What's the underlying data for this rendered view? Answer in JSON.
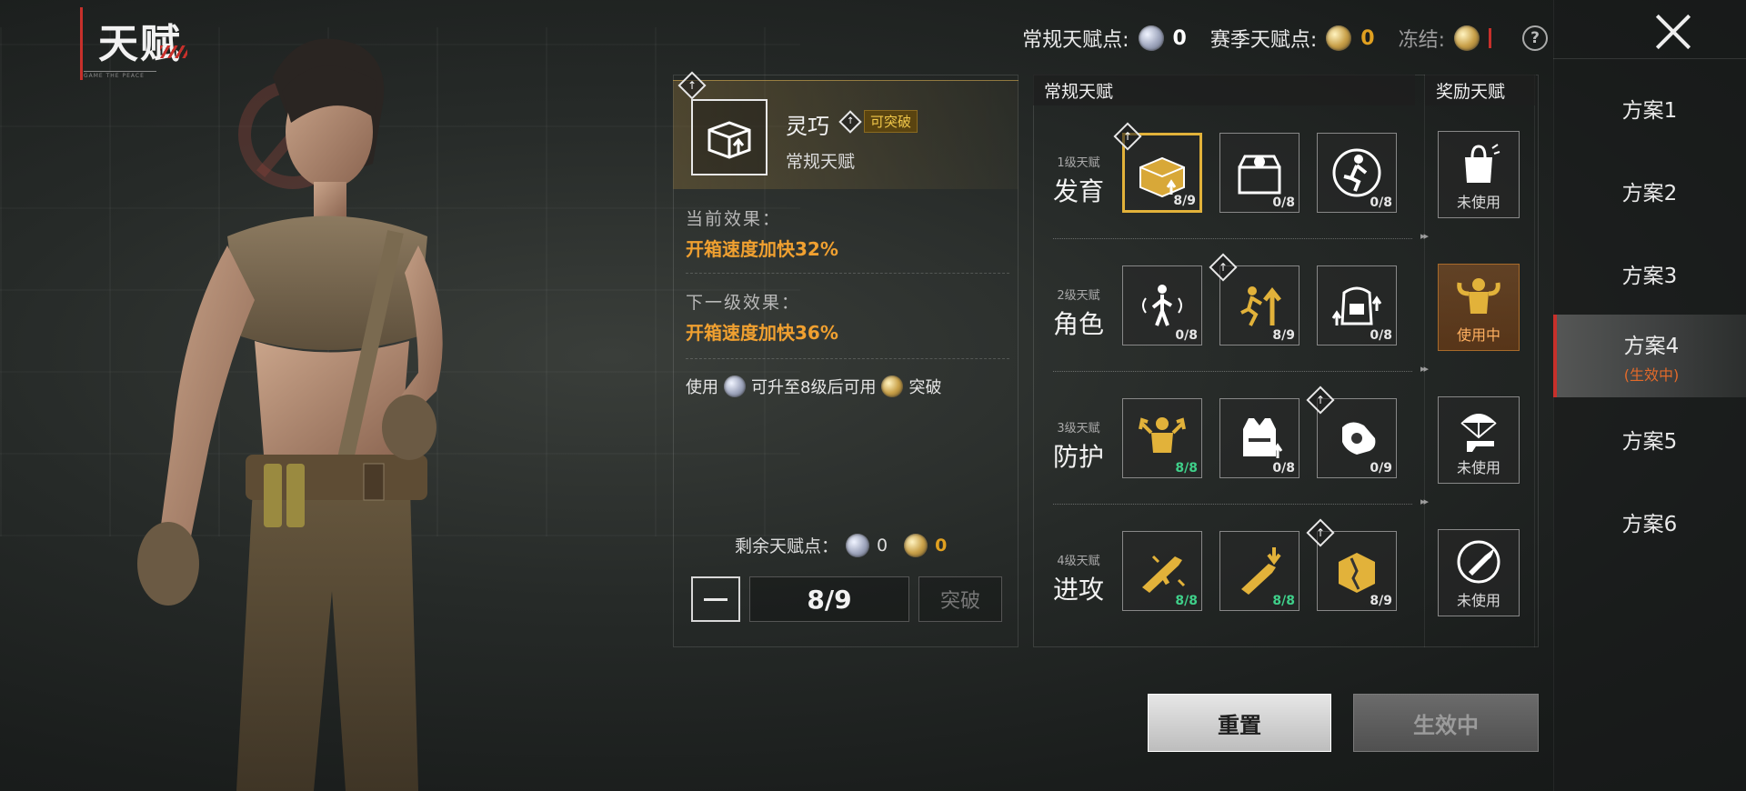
{
  "title": "天赋",
  "title_sub": "GAME THE PEACE",
  "points": {
    "regular_label": "常规天赋点:",
    "regular_value": "0",
    "season_label": "赛季天赋点:",
    "season_value": "0",
    "frozen_label": "冻结:",
    "help": "?"
  },
  "plans": [
    {
      "label": "方案1",
      "status": ""
    },
    {
      "label": "方案2",
      "status": ""
    },
    {
      "label": "方案3",
      "status": ""
    },
    {
      "label": "方案4",
      "status": "(生效中)",
      "active": true
    },
    {
      "label": "方案5",
      "status": ""
    },
    {
      "label": "方案6",
      "status": ""
    }
  ],
  "detail": {
    "name": "灵巧",
    "break_badge": "可突破",
    "type": "常规天赋",
    "current_label": "当前效果：",
    "current_value": "开箱速度加快32%",
    "next_label": "下一级效果：",
    "next_value": "开箱速度加快36%",
    "unlock_prefix": "使用",
    "unlock_mid": "可升至8级后可用",
    "unlock_suffix": "突破",
    "remain_label": "剩余天赋点：",
    "remain_regular": "0",
    "remain_season": "0",
    "level": "8/9",
    "break_button": "突破"
  },
  "grid": {
    "regular_header": "常规天赋",
    "reward_header": "奖励天赋",
    "tiers": [
      {
        "small": "1级天赋",
        "big": "发育",
        "slots": [
          {
            "icon": "loot-crate-icon",
            "count": "8/9",
            "max": false,
            "selected": true,
            "diamond": true
          },
          {
            "icon": "supply-box-icon",
            "count": "0/8",
            "max": false,
            "selected": false,
            "diamond": false
          },
          {
            "icon": "sprint-soldier-icon",
            "count": "0/8",
            "max": false,
            "selected": false,
            "diamond": false
          }
        ]
      },
      {
        "small": "2级天赋",
        "big": "角色",
        "slots": [
          {
            "icon": "sound-soldier-icon",
            "count": "0/8",
            "max": false,
            "selected": false,
            "diamond": false
          },
          {
            "icon": "running-soldier-icon",
            "count": "8/9",
            "max": false,
            "selected": false,
            "diamond": true
          },
          {
            "icon": "backpack-icon",
            "count": "0/8",
            "max": false,
            "selected": false,
            "diamond": false
          }
        ]
      },
      {
        "small": "3级天赋",
        "big": "防护",
        "slots": [
          {
            "icon": "strength-soldier-icon",
            "count": "8/8",
            "max": true,
            "selected": false,
            "diamond": false
          },
          {
            "icon": "armor-vest-icon",
            "count": "0/8",
            "max": false,
            "selected": false,
            "diamond": false
          },
          {
            "icon": "glove-icon",
            "count": "0/9",
            "max": false,
            "selected": false,
            "diamond": true
          }
        ]
      },
      {
        "small": "4级天赋",
        "big": "进攻",
        "slots": [
          {
            "icon": "rifle-icon",
            "count": "8/8",
            "max": true,
            "selected": false,
            "diamond": false
          },
          {
            "icon": "rifle-down-icon",
            "count": "8/8",
            "max": true,
            "selected": false,
            "diamond": false
          },
          {
            "icon": "broken-box-icon",
            "count": "8/9",
            "max": false,
            "selected": false,
            "diamond": true
          }
        ]
      }
    ],
    "rewards": [
      {
        "icon": "bag-lock-icon",
        "state": "未使用",
        "in_use": false
      },
      {
        "icon": "muscle-soldier-icon",
        "state": "使用中",
        "in_use": true
      },
      {
        "icon": "parachute-gun-icon",
        "state": "未使用",
        "in_use": false
      },
      {
        "icon": "bullet-icon",
        "state": "未使用",
        "in_use": false
      }
    ]
  },
  "buttons": {
    "reset": "重置",
    "active": "生效中"
  }
}
